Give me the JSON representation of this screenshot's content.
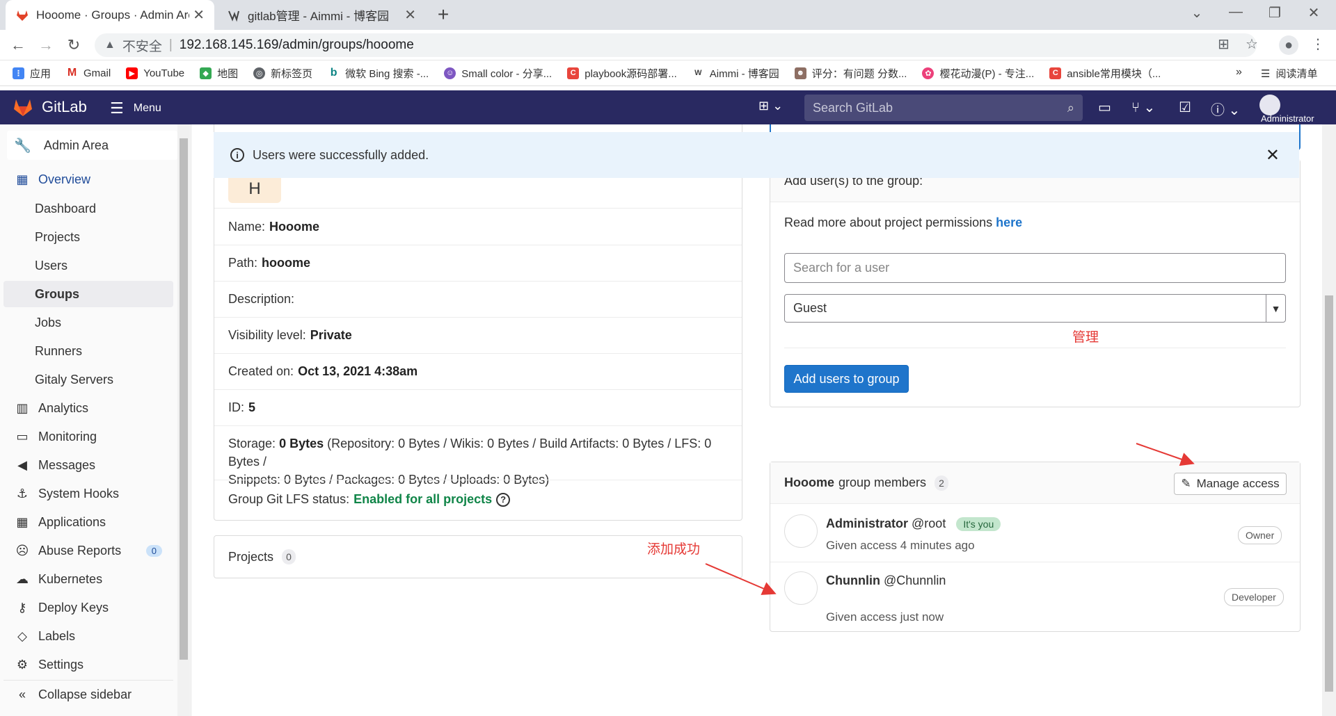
{
  "browser": {
    "tabs": [
      {
        "title": "Hooome · Groups · Admin Area",
        "close": "✕"
      },
      {
        "title": "gitlab管理 - Aimmi - 博客园",
        "close": "✕"
      }
    ],
    "new_tab": "+",
    "address": {
      "insecure_label": "不安全",
      "separator": "|",
      "url": "192.168.145.169/admin/groups/hooome"
    },
    "bookmarks": [
      {
        "label": "应用",
        "icon_color": "#e8453c"
      },
      {
        "label": "Gmail",
        "icon_color": "#d93025"
      },
      {
        "label": "YouTube",
        "icon_color": "#ff0000"
      },
      {
        "label": "地图",
        "icon_color": "#34a853"
      },
      {
        "label": "新标签页",
        "icon_color": "#5f6368"
      },
      {
        "label": "微软 Bing 搜索 -...",
        "icon_color": "#0c8484"
      },
      {
        "label": "Small color - 分享...",
        "icon_color": "#7e57c2"
      },
      {
        "label": "playbook源码部署...",
        "icon_color": "#e8453c"
      },
      {
        "label": "Aimmi - 博客园",
        "icon_color": "#444444"
      },
      {
        "label": "评分：有问题 分数...",
        "icon_color": "#8d6e63"
      },
      {
        "label": "樱花动漫(P) - 专注...",
        "icon_color": "#ec407a"
      },
      {
        "label": "ansible常用模块（...",
        "icon_color": "#e8453c"
      }
    ],
    "bookmarks_more": "»",
    "reading_list": "阅读清单"
  },
  "gitlab": {
    "brand": "GitLab",
    "menu_label": "Menu",
    "search_placeholder": "Search GitLab",
    "user_label": "Administrator",
    "colors": {
      "header": "#292961",
      "primary": "#1f75cb",
      "success": "#108548"
    }
  },
  "sidebar": {
    "title": "Admin Area",
    "overview": "Overview",
    "sub_items": [
      "Dashboard",
      "Projects",
      "Users",
      "Groups",
      "Jobs",
      "Runners",
      "Gitaly Servers"
    ],
    "sections": [
      {
        "label": "Analytics",
        "icon": "chart-icon"
      },
      {
        "label": "Monitoring",
        "icon": "monitor-icon"
      },
      {
        "label": "Messages",
        "icon": "megaphone-icon"
      },
      {
        "label": "System Hooks",
        "icon": "hook-icon"
      },
      {
        "label": "Applications",
        "icon": "grid-icon"
      },
      {
        "label": "Abuse Reports",
        "icon": "abuse-icon",
        "badge": "0"
      },
      {
        "label": "Kubernetes",
        "icon": "kubernetes-icon"
      },
      {
        "label": "Deploy Keys",
        "icon": "key-icon"
      },
      {
        "label": "Labels",
        "icon": "label-icon"
      },
      {
        "label": "Settings",
        "icon": "gear-icon"
      }
    ],
    "collapse": "Collapse sidebar"
  },
  "alert": {
    "message": "Users were successfully added.",
    "close": "✕"
  },
  "group_info": {
    "avatar_letter": "H",
    "name_label": "Name:",
    "name": "Hooome",
    "path_label": "Path:",
    "path": "hooome",
    "description_label": "Description:",
    "visibility_label": "Visibility level:",
    "visibility": "Private",
    "created_label": "Created on:",
    "created": "Oct 13, 2021 4:38am",
    "id_label": "ID:",
    "id": "5",
    "storage_label": "Storage:",
    "storage_total": "0 Bytes",
    "storage_detail_1": "(Repository: 0 Bytes / Wikis: 0 Bytes / Build Artifacts: 0 Bytes / LFS: 0 Bytes /",
    "storage_detail_2": "Snippets: 0 Bytes / Packages: 0 Bytes / Uploads: 0 Bytes)",
    "lfs_label": "Group Git LFS status:",
    "lfs_status": "Enabled for all projects"
  },
  "projects": {
    "label": "Projects",
    "count": "0"
  },
  "add_users": {
    "header": "Add user(s) to the group:",
    "read_more": "Read more about project permissions",
    "read_more_link": "here",
    "search_placeholder": "Search for a user",
    "role_selected": "Guest",
    "submit": "Add users to group"
  },
  "members": {
    "group_name": "Hooome",
    "title_suffix": "group members",
    "count": "2",
    "manage_access": "Manage access",
    "list": [
      {
        "name": "Administrator",
        "username": "@root",
        "badge": "It's you",
        "access": "Given access 4 minutes ago",
        "role": "Owner"
      },
      {
        "name": "Chunnlin",
        "username": "@Chunnlin",
        "access": "Given access just now",
        "role": "Developer"
      }
    ]
  },
  "annotations": {
    "manage": "管理",
    "added": "添加成功"
  }
}
